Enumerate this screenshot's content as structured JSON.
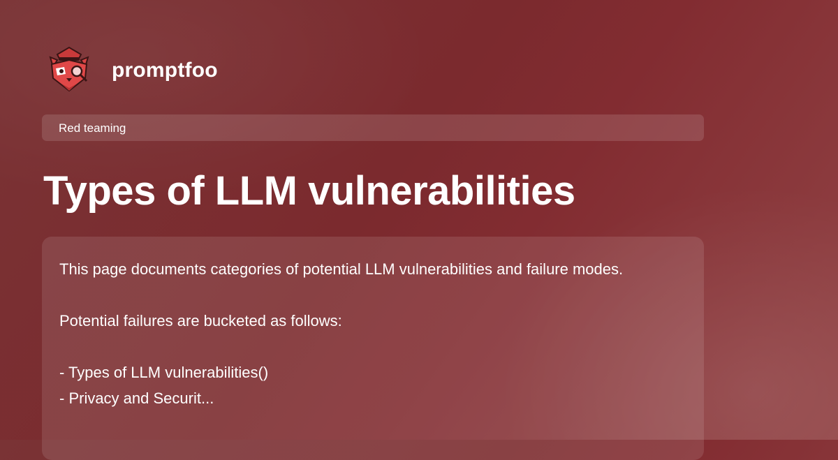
{
  "brand": {
    "name": "promptfoo",
    "logo_icon": "red-panda-detective-icon"
  },
  "category": {
    "label": "Red teaming"
  },
  "page": {
    "title": "Types of LLM vulnerabilities",
    "description": "This page documents categories of potential LLM vulnerabilities and failure modes.\n\nPotential failures are bucketed as follows:\n\n- Types of LLM vulnerabilities()\n- Privacy and Securit..."
  },
  "colors": {
    "background": "#7b2a2e",
    "text": "#ffffff",
    "logo_red": "#e04848"
  }
}
